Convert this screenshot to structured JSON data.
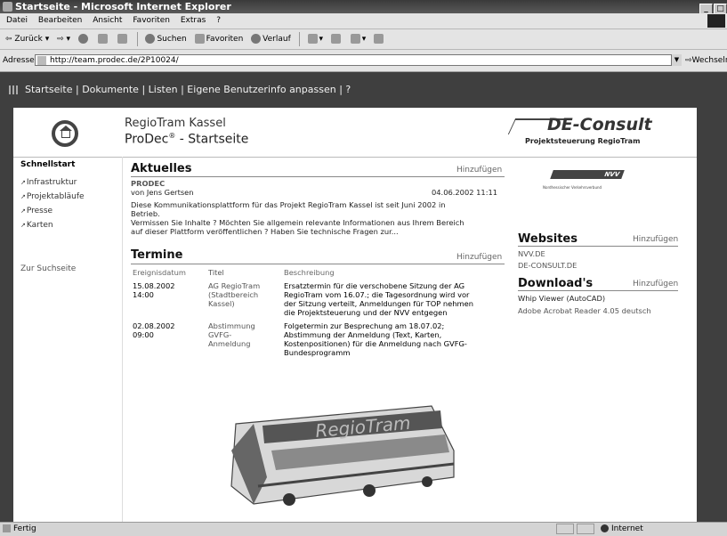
{
  "window": {
    "title": "Startseite - Microsoft Internet Explorer"
  },
  "menu": [
    "Datei",
    "Bearbeiten",
    "Ansicht",
    "Favoriten",
    "Extras",
    "?"
  ],
  "toolbar": {
    "back": "Zurück",
    "search": "Suchen",
    "favorites": "Favoriten",
    "history": "Verlauf"
  },
  "address": {
    "label": "Adresse",
    "url": "http://team.prodec.de/2P10024/",
    "go": "Wechseln z"
  },
  "nav": {
    "text": "Startseite | Dokumente | Listen | Eigene Benutzerinfo anpassen | ?"
  },
  "header": {
    "site_line1": "RegioTram Kassel",
    "site_line2_prefix": "ProDec",
    "site_line2_sup": "®",
    "site_line2_suffix": " - Startseite",
    "logo_name": "DE-Consult",
    "logo_sub": "Projektsteuerung RegioTram"
  },
  "quickstart": {
    "title": "Schnellstart",
    "items": [
      "Infrastruktur",
      "Projektabläufe",
      "Presse",
      "Karten"
    ],
    "search_link": "Zur Suchseite"
  },
  "aktuelles": {
    "heading": "Aktuelles",
    "add": "Hinzufügen",
    "tag": "PRODEC",
    "author": "von Jens Gertsen",
    "date": "04.06.2002 11:11",
    "text1": "Diese Kommunikationsplattform für das Projekt RegioTram Kassel ist seit Juni 2002 in",
    "text2": "Betrieb.",
    "text3": "Vermissen Sie Inhalte ? Möchten Sie allgemein relevante Informationen aus Ihrem Bereich",
    "text4": "auf dieser Plattform veröffentlichen ? Haben Sie technische Fragen zur..."
  },
  "termine": {
    "heading": "Termine",
    "add": "Hinzufügen",
    "columns": [
      "Ereignisdatum",
      "Titel",
      "Beschreibung"
    ],
    "rows": [
      {
        "date": "15.08.2002 14:00",
        "title_lines": [
          "AG RegioTram",
          "(Stadtbereich",
          "Kassel)"
        ],
        "desc_lines": [
          "Ersatztermin für die verschobene Sitzung der AG",
          "RegioTram vom 16.07.; die Tagesordnung wird vor",
          "der Sitzung verteilt, Anmeldungen für TOP nehmen",
          "die Projektsteuerung und der NVV entgegen"
        ]
      },
      {
        "date": "02.08.2002 09:00",
        "title_lines": [
          "Abstimmung",
          "GVFG-Anmeldung"
        ],
        "desc_lines": [
          "Folgetermin zur Besprechung am 18.07.02;",
          "Abstimmung der Anmeldung (Text, Karten,",
          "Kostenpositionen) für die Anmeldung nach GVFG-",
          "Bundesprogramm"
        ]
      }
    ]
  },
  "nvv": {
    "logo": "NVV",
    "sub": "Nordhessischer Verkehrsverbund"
  },
  "websites": {
    "heading": "Websites",
    "add": "Hinzufügen",
    "items": [
      "NVV.DE",
      "DE-CONSULT.DE"
    ]
  },
  "downloads": {
    "heading": "Download's",
    "add": "Hinzufügen",
    "items": [
      "Whip Viewer (AutoCAD)",
      "Adobe Acrobat Reader 4.05 deutsch"
    ]
  },
  "tram": {
    "lettering": "RegioTram"
  },
  "status": {
    "left": "Fertig",
    "zone": "Internet"
  }
}
